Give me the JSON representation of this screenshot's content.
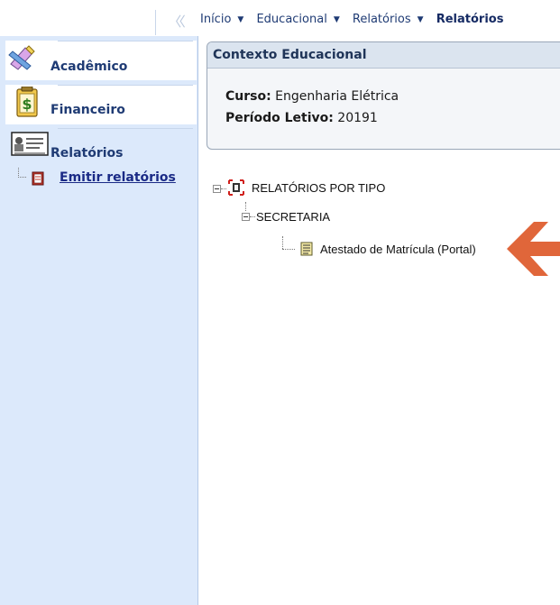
{
  "sidebar": {
    "collapse_label": "《",
    "tabs": [
      {
        "label": "Acadêmico",
        "icon": "pencil-ruler-icon"
      },
      {
        "label": "Financeiro",
        "icon": "dollar-document-icon"
      },
      {
        "label": "Relatórios",
        "icon": "report-card-icon"
      }
    ],
    "report_link": {
      "label": "Emitir relatórios",
      "icon": "report-book-icon"
    }
  },
  "nav": {
    "items": [
      "Início",
      "Educacional",
      "Relatórios"
    ],
    "current": "Relatórios",
    "caret": "▼"
  },
  "context": {
    "title": "Contexto Educacional",
    "curso_label": "Curso:",
    "curso_value": "Engenharia Elétrica",
    "periodo_label": "Período Letivo:",
    "periodo_value": "20191"
  },
  "tree": {
    "root": "RELATÓRIOS POR TIPO",
    "folder": "SECRETARIA",
    "leaf": "Atestado de Matrícula (Portal)"
  },
  "colors": {
    "sidebar_bg": "#dce9fb",
    "link": "#1a2a86",
    "arrow": "#e0663a"
  }
}
